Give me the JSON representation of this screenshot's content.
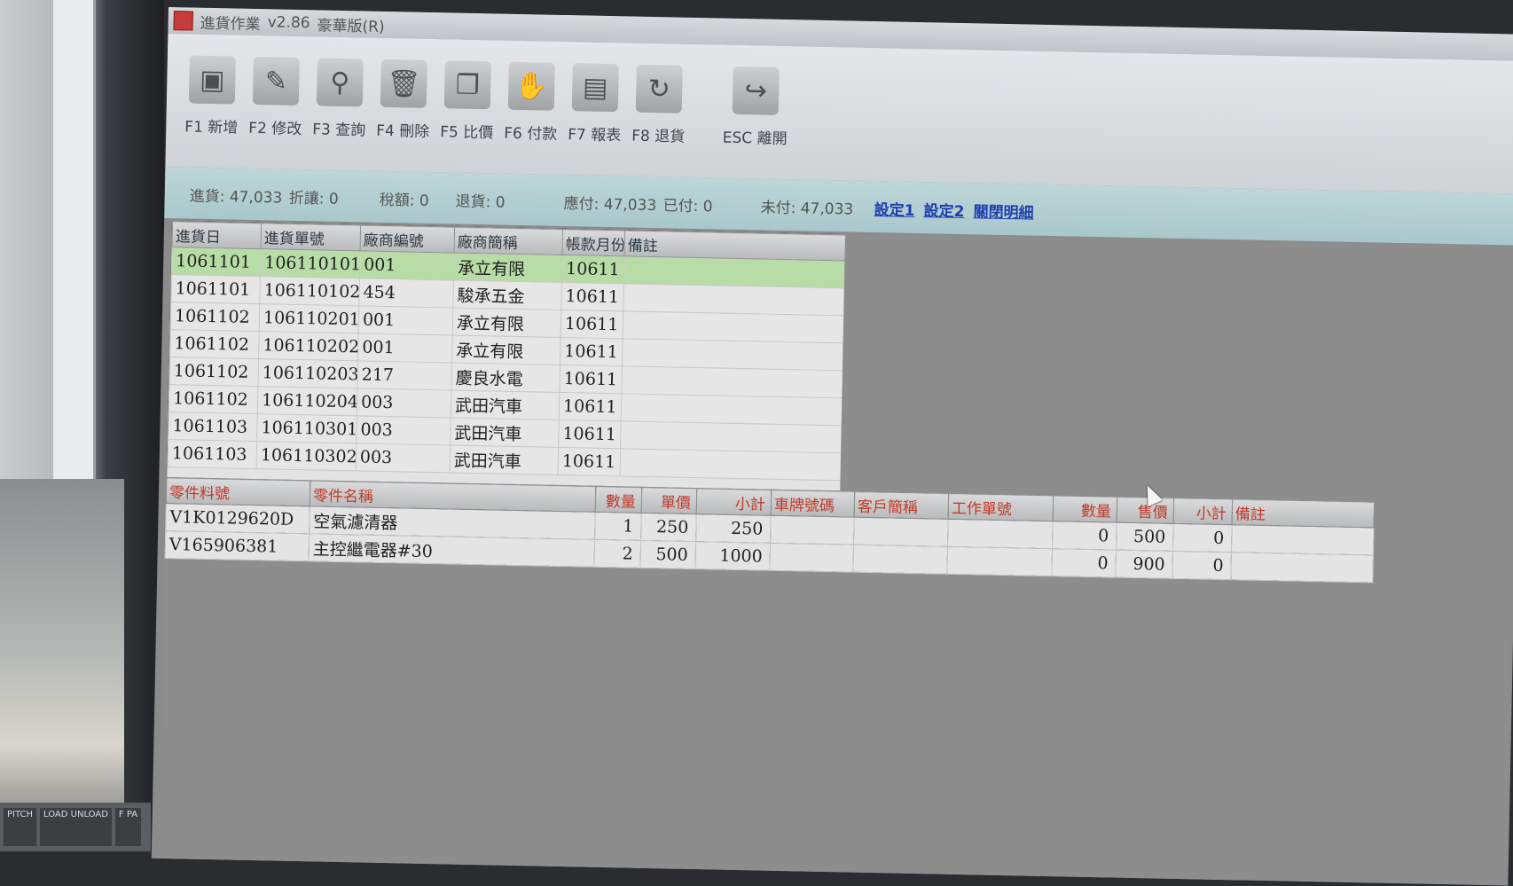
{
  "window": {
    "title": "進貨作業",
    "version": "v2.86",
    "edition": "豪華版(R)"
  },
  "toolbar": [
    {
      "key": "F1",
      "label": "F1 新增",
      "icon": "new-doc-icon",
      "glyph": "▣"
    },
    {
      "key": "F2",
      "label": "F2 修改",
      "icon": "brush-icon",
      "glyph": "✎"
    },
    {
      "key": "F3",
      "label": "F3 查詢",
      "icon": "magnifier-icon",
      "glyph": "⚲"
    },
    {
      "key": "F4",
      "label": "F4 刪除",
      "icon": "trash-icon",
      "glyph": "🗑"
    },
    {
      "key": "F5",
      "label": "F5 比價",
      "icon": "compare-docs-icon",
      "glyph": "❐"
    },
    {
      "key": "F6",
      "label": "F6 付款",
      "icon": "payment-icon",
      "glyph": "✋"
    },
    {
      "key": "F7",
      "label": "F7 報表",
      "icon": "report-icon",
      "glyph": "▤"
    },
    {
      "key": "F8",
      "label": "F8 退貨",
      "icon": "return-icon",
      "glyph": "↻"
    },
    {
      "key": "ESC",
      "label": "ESC 離開",
      "icon": "exit-arrow-icon",
      "glyph": "↪"
    }
  ],
  "summary": {
    "purchase": "進貨: 47,033",
    "discount": "折讓: 0",
    "tax": "稅額: 0",
    "returns": "退貨: 0",
    "payable": "應付: 47,033",
    "paid": "已付: 0",
    "unpaid": "未付: 47,033",
    "link_setting1": "設定1",
    "link_setting2": "設定2",
    "link_toggle_detail": "關閉明細"
  },
  "master": {
    "headers": [
      "進貨日",
      "進貨單號",
      "廠商編號",
      "廠商簡稱",
      "帳款月份",
      "備註"
    ],
    "selected_index": 0,
    "rows": [
      [
        "1061101",
        "106110101",
        "001",
        "承立有限",
        "10611",
        ""
      ],
      [
        "1061101",
        "106110102",
        "454",
        "駿承五金",
        "10611",
        ""
      ],
      [
        "1061102",
        "106110201",
        "001",
        "承立有限",
        "10611",
        ""
      ],
      [
        "1061102",
        "106110202",
        "001",
        "承立有限",
        "10611",
        ""
      ],
      [
        "1061102",
        "106110203",
        "217",
        "慶良水電",
        "10611",
        ""
      ],
      [
        "1061102",
        "106110204",
        "003",
        "武田汽車",
        "10611",
        ""
      ],
      [
        "1061103",
        "106110301",
        "003",
        "武田汽車",
        "10611",
        ""
      ],
      [
        "1061103",
        "106110302",
        "003",
        "武田汽車",
        "10611",
        ""
      ]
    ]
  },
  "detail": {
    "headers": [
      "零件料號",
      "零件名稱",
      "數量",
      "單價",
      "小計",
      "車牌號碼",
      "客戶簡稱",
      "工作單號",
      "數量",
      "售價",
      "小計",
      "備註"
    ],
    "rows": [
      [
        "V1K0129620D",
        "空氣濾清器",
        "1",
        "250",
        "250",
        "",
        "",
        "",
        "0",
        "500",
        "0",
        ""
      ],
      [
        "V165906381",
        "主控繼電器#30",
        "2",
        "500",
        "1000",
        "",
        "",
        "",
        "0",
        "900",
        "0",
        ""
      ]
    ]
  },
  "keypad": [
    "PITCH",
    "LOAD UNLOAD",
    "F PA"
  ]
}
